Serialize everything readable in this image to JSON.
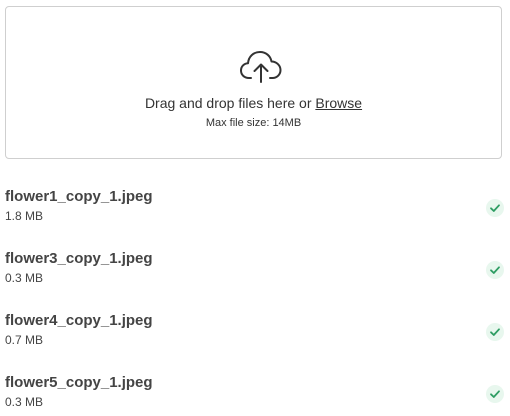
{
  "upload": {
    "drop_text": "Drag and drop files here or ",
    "browse_label": "Browse",
    "max_size": "Max file size: 14MB",
    "icon": "cloud-upload-icon"
  },
  "files": [
    {
      "name": "flower1_copy_1.jpeg",
      "size": "1.8 MB",
      "status": "uploaded"
    },
    {
      "name": "flower3_copy_1.jpeg",
      "size": "0.3 MB",
      "status": "uploaded"
    },
    {
      "name": "flower4_copy_1.jpeg",
      "size": "0.7 MB",
      "status": "uploaded"
    },
    {
      "name": "flower5_copy_1.jpeg",
      "size": "0.3 MB",
      "status": "uploaded"
    }
  ],
  "colors": {
    "border": "#cfcfcf",
    "success": "#2e9d63",
    "success_bg": "#e8f7ee",
    "text": "#333333"
  }
}
